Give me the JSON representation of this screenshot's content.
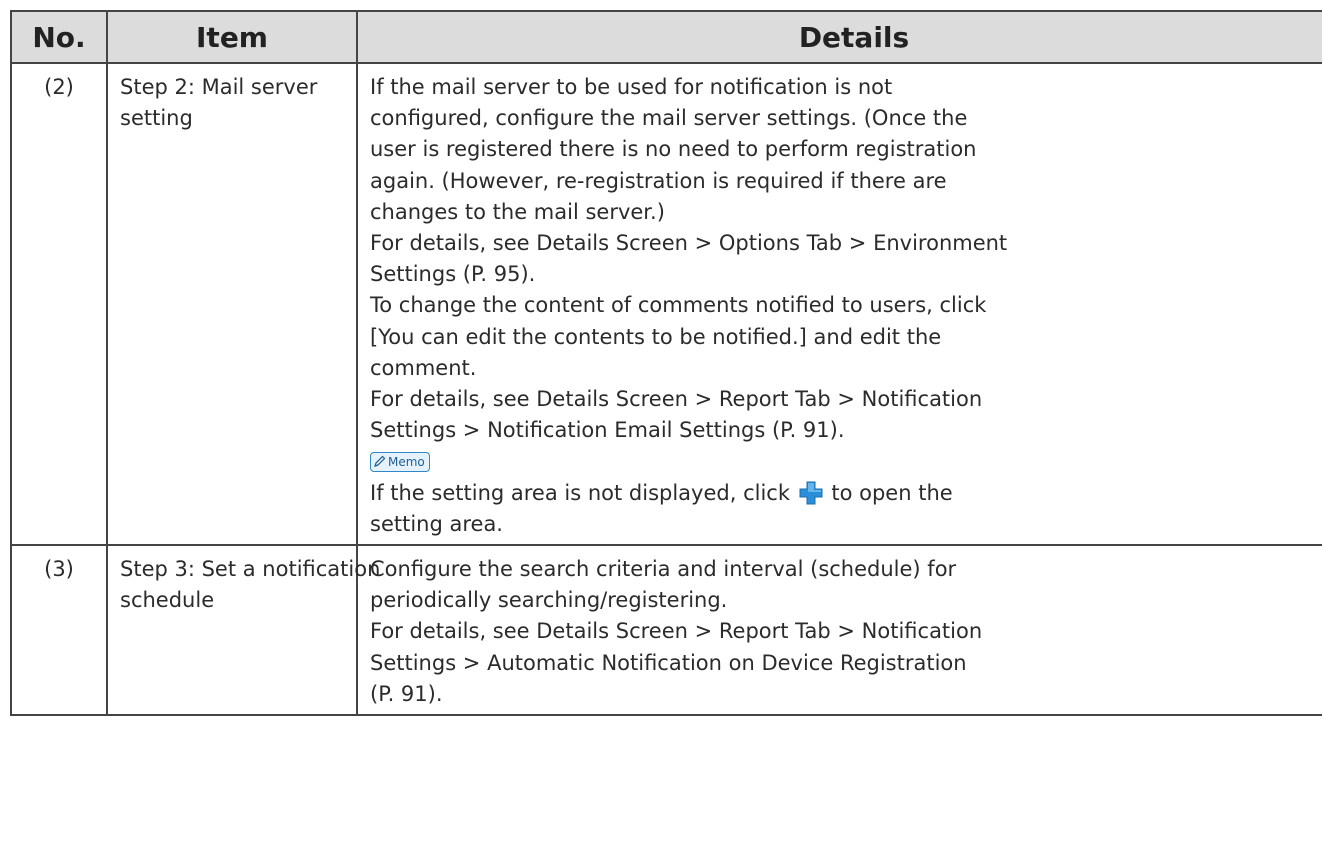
{
  "table": {
    "headers": {
      "no": "No.",
      "item": "Item",
      "details": "Details"
    },
    "rows": [
      {
        "no": "(2)",
        "item": [
          "Step 2: Mail server",
          "setting"
        ],
        "details": {
          "lines_a": [
            "If the mail server to be used for notification is not",
            "configured, configure the mail server settings. (Once the",
            "user is registered there is no need to perform registration",
            "again. (However, re-registration is required if there are",
            "changes to the mail server.)",
            "For details, see Details Screen > Options Tab > Environment",
            "Settings (P. 95).",
            "To change the content of comments notified to users, click",
            "[You can edit the contents to be notified.] and edit the",
            "comment.",
            "For details, see Details Screen > Report Tab > Notification",
            "Settings > Notification Email Settings (P. 91)."
          ],
          "memo_label": "Memo",
          "memo_before": "If the setting area is not displayed, click",
          "memo_after": "to open the",
          "memo_line2": "setting area.",
          "plus_icon": "blue-plus-icon"
        }
      },
      {
        "no": "(3)",
        "item": [
          "Step 3: Set a notification",
          "schedule"
        ],
        "details": {
          "lines": [
            "Configure the search criteria and interval (schedule) for",
            "periodically searching/registering.",
            "For details, see Details Screen > Report Tab > Notification",
            "Settings > Automatic Notification on Device Registration",
            "(P. 91)."
          ]
        }
      }
    ]
  },
  "colors": {
    "header_bg": "#dcdcdc",
    "border": "#444444",
    "memo_blue": "#2f88c8",
    "plus_blue": "#2a8fd8"
  }
}
